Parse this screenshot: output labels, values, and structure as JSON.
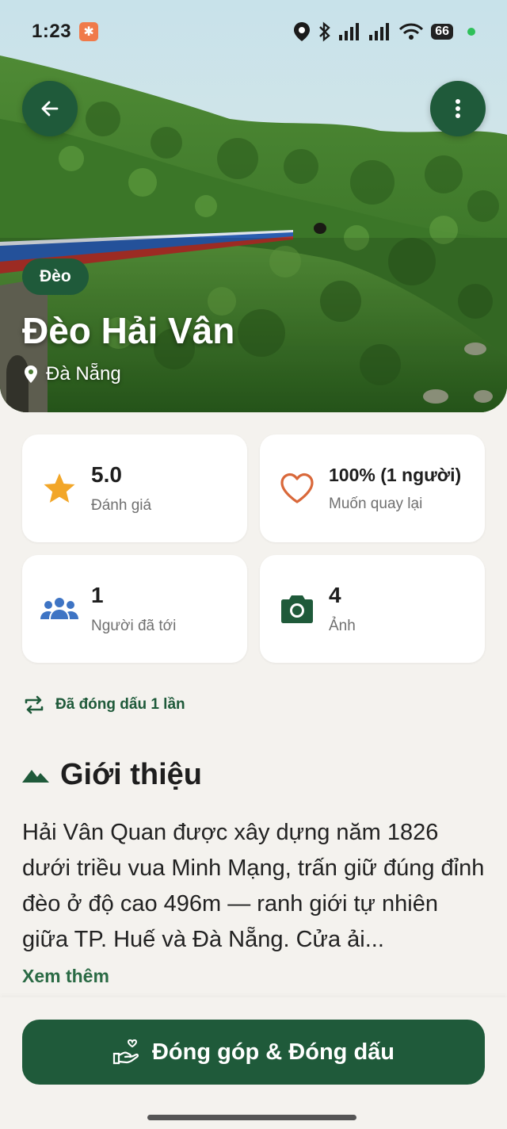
{
  "status": {
    "time": "1:23",
    "battery": "66"
  },
  "hero": {
    "category": "Đèo",
    "title": "Đèo Hải Vân",
    "location": "Đà Nẵng"
  },
  "stats": [
    {
      "value": "5.0",
      "label": "Đánh giá",
      "icon": "star-icon",
      "color": "#f2a628"
    },
    {
      "value": "100% (1 người)",
      "label": "Muốn quay lại",
      "icon": "heart-icon",
      "color": "#d9683a"
    },
    {
      "value": "1",
      "label": "Người đã tới",
      "icon": "people-icon",
      "color": "#3e74c4"
    },
    {
      "value": "4",
      "label": "Ảnh",
      "icon": "camera-icon",
      "color": "#1f5a3a"
    }
  ],
  "stamp": {
    "text": "Đã đóng dấu 1 lần"
  },
  "intro": {
    "heading": "Giới thiệu",
    "body": "Hải Vân Quan được xây dựng năm 1826 dưới triều vua Minh Mạng, trấn giữ đúng đỉnh đèo ở độ cao 496m — ranh giới tự nhiên giữa TP. Huế và Đà Nẵng. Cửa ải...",
    "see_more": "Xem thêm"
  },
  "cta": {
    "label": "Đóng góp & Đóng dấu"
  },
  "colors": {
    "primary": "#1f5a3a",
    "background": "#f4f2ee"
  }
}
